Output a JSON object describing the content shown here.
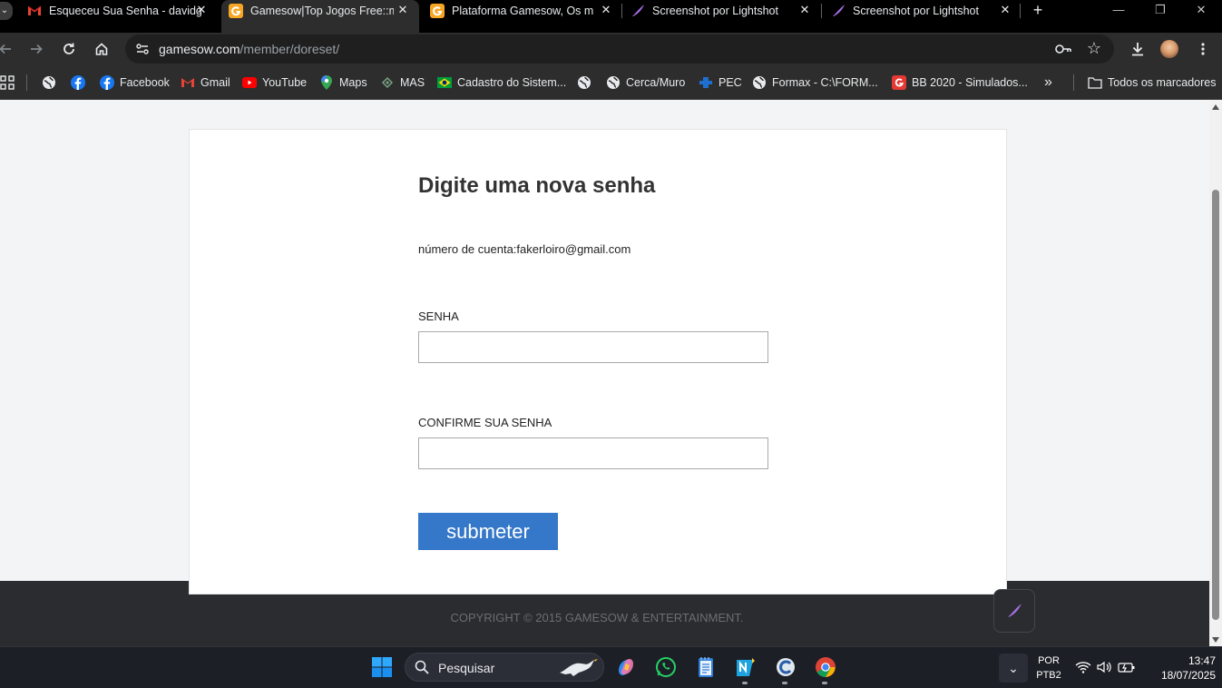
{
  "browser": {
    "tabs": [
      {
        "title": "Esqueceu Sua Senha - davidg",
        "favicon": "gmail-icon",
        "active": false
      },
      {
        "title": "Gamesow|Top Jogos Free::m",
        "favicon": "gamesow-icon",
        "active": true
      },
      {
        "title": "Plataforma Gamesow,  Os m",
        "favicon": "gamesow-icon",
        "active": false
      },
      {
        "title": "Screenshot por Lightshot",
        "favicon": "lightshot-feather-icon",
        "active": false
      },
      {
        "title": "Screenshot por Lightshot",
        "favicon": "lightshot-feather-icon",
        "active": false
      }
    ],
    "address": {
      "host": "gamesow.com",
      "path": "/member/doreset/"
    },
    "bookmarks": [
      {
        "label": "",
        "icon": "globe-icon"
      },
      {
        "label": "",
        "icon": "facebook-icon"
      },
      {
        "label": "Facebook",
        "icon": "facebook-icon"
      },
      {
        "label": "Gmail",
        "icon": "gmail-icon"
      },
      {
        "label": "YouTube",
        "icon": "youtube-icon"
      },
      {
        "label": "Maps",
        "icon": "maps-pin-icon"
      },
      {
        "label": "MAS",
        "icon": "mas-icon"
      },
      {
        "label": "Cadastro do Sistem...",
        "icon": "brazil-flag-icon"
      },
      {
        "label": "",
        "icon": "globe-icon"
      },
      {
        "label": "Cerca/Muro",
        "icon": "globe-icon"
      },
      {
        "label": "PEC",
        "icon": "pec-icon"
      },
      {
        "label": "Formax - C:\\FORM...",
        "icon": "globe-icon"
      },
      {
        "label": "BB 2020 - Simulados...",
        "icon": "g-red-icon"
      }
    ],
    "all_bookmarks_label": "Todos os marcadores"
  },
  "page": {
    "heading": "Digite uma nova senha",
    "account_text": "número de cuenta:fakerloiro@gmail.com",
    "password_label": "SENHA",
    "password_value": "",
    "confirm_label": "CONFIRME SUA SENHA",
    "confirm_value": "",
    "submit_label": "submeter",
    "copyright": "COPYRIGHT © 2015 GAMESOW & ENTERTAINMENT."
  },
  "taskbar": {
    "search_placeholder": "Pesquisar",
    "lang_top": "POR",
    "lang_bottom": "PTB2",
    "time": "13:47",
    "date": "18/07/2025"
  },
  "colors": {
    "submit_button": "#3577c9",
    "footer_band": "#2a2c2f",
    "page_bg": "#f3f4f6"
  }
}
